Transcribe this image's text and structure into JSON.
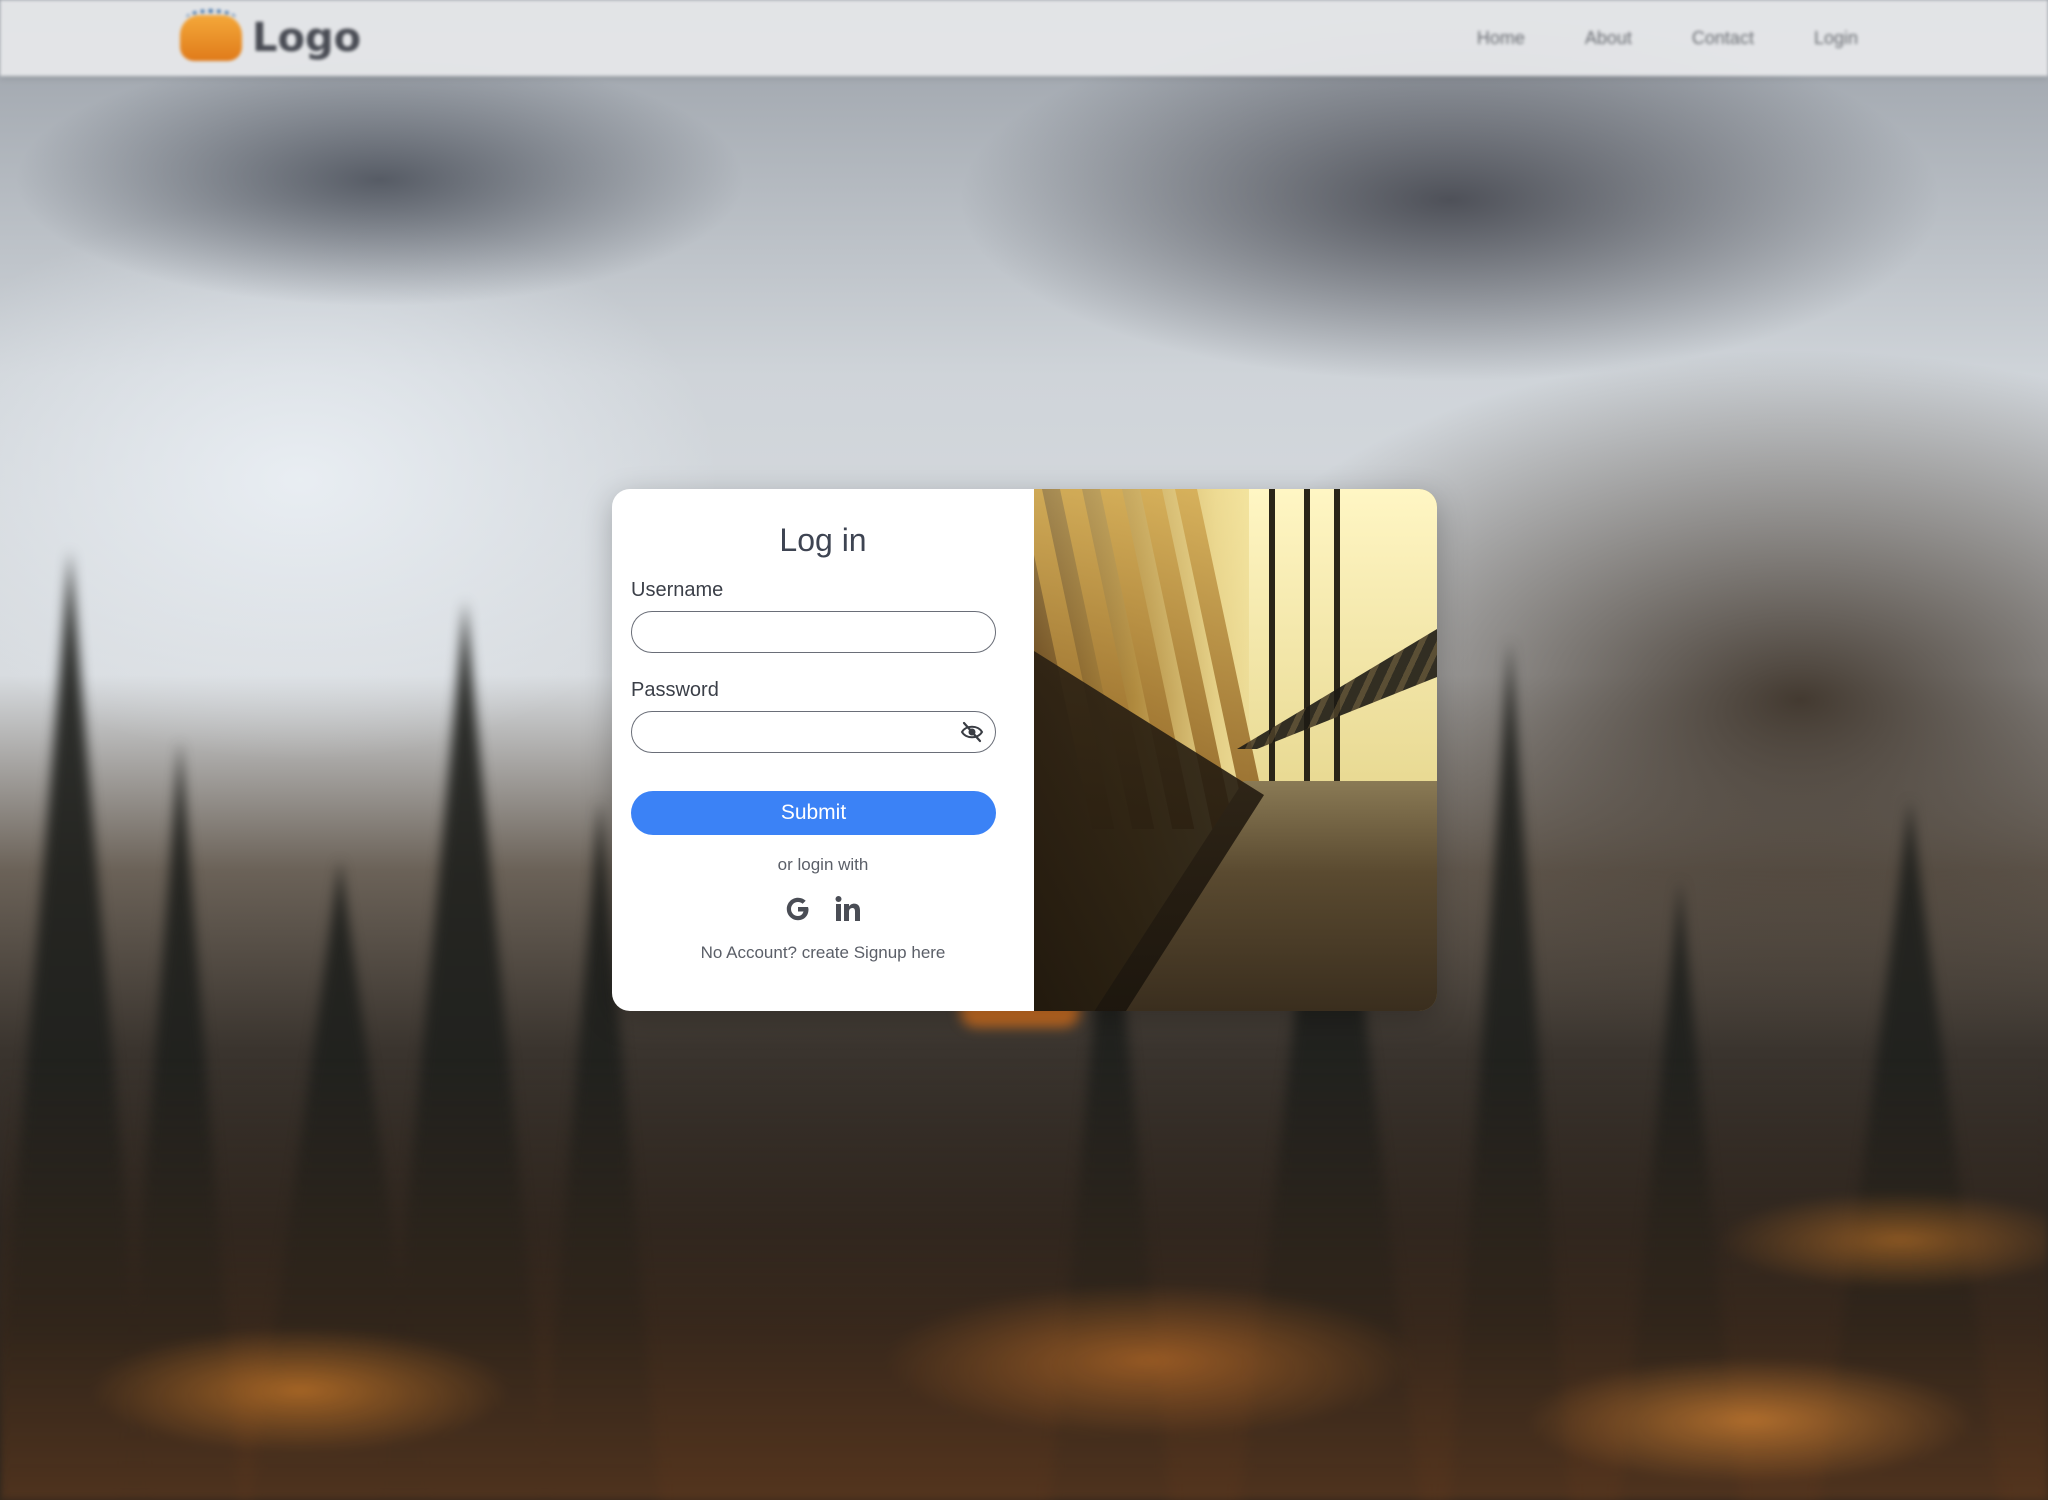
{
  "navbar": {
    "logo_text": "Logo",
    "links": [
      "Home",
      "About",
      "Contact",
      "Login"
    ]
  },
  "login": {
    "title": "Log in",
    "username_label": "Username",
    "username_value": "",
    "password_label": "Password",
    "password_value": "",
    "submit_label": "Submit",
    "alt_login_text": "or login with",
    "social": [
      {
        "icon": "google-icon",
        "label": "G"
      },
      {
        "icon": "linkedin-icon",
        "label": "in"
      }
    ],
    "signup_text": "No Account? create Signup here"
  },
  "colors": {
    "accent": "#3b82f6",
    "card_bg": "#ffffff",
    "text": "#3e4452"
  },
  "icons": {
    "password_toggle": "eye-off-icon"
  }
}
